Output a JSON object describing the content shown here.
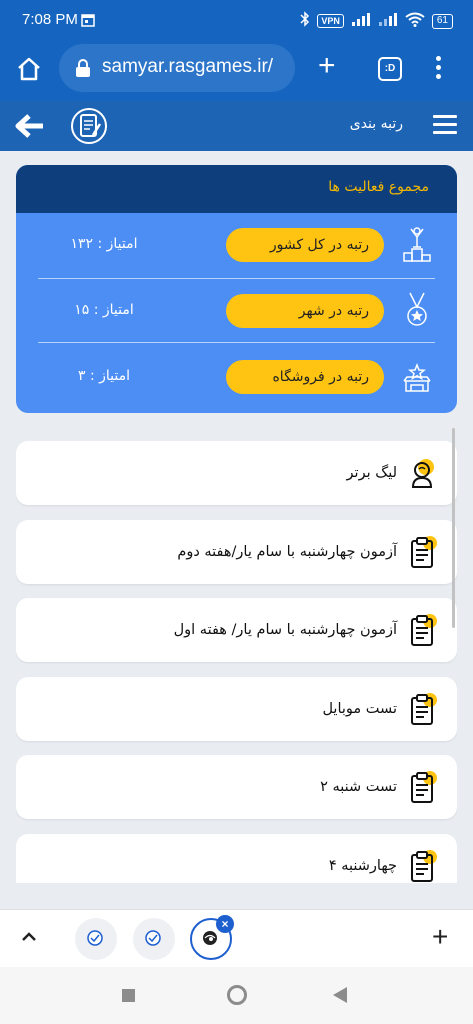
{
  "status_bar": {
    "time": "7:08 PM",
    "vpn": "VPN",
    "battery": "61"
  },
  "browser": {
    "url": "samyar.rasgames.ir/",
    "tabs_label": ":D"
  },
  "app_header": {
    "title": "رتبه بندی"
  },
  "summary": {
    "title": "مجموع فعالیت ها",
    "rows": [
      {
        "label": "رتبه در کل کشور",
        "score": "امتیاز : ۱۳۲",
        "icon": "podium-icon"
      },
      {
        "label": "رتبه در شهر",
        "score": "امتیاز : ۱۵",
        "icon": "medal-icon"
      },
      {
        "label": "رتبه در فروشگاه",
        "score": "امتیاز : ۳",
        "icon": "shop-star-icon"
      }
    ]
  },
  "items": [
    {
      "label": "لیگ برتر",
      "icon": "league-icon"
    },
    {
      "label": "آزمون چهارشنبه با سام یار/هفته دوم",
      "icon": "clipboard-icon"
    },
    {
      "label": "آزمون چهارشنبه با سام یار/ هفته اول",
      "icon": "clipboard-icon"
    },
    {
      "label": "تست موبایل",
      "icon": "clipboard-icon"
    },
    {
      "label": "تست شنبه ۲",
      "icon": "clipboard-icon"
    },
    {
      "label": "چهارشنبه ۴",
      "icon": "clipboard-icon"
    }
  ],
  "colors": {
    "primary": "#1565c0",
    "card": "#4d8ef5",
    "card_header": "#0e3f7c",
    "accent": "#ffc412"
  }
}
